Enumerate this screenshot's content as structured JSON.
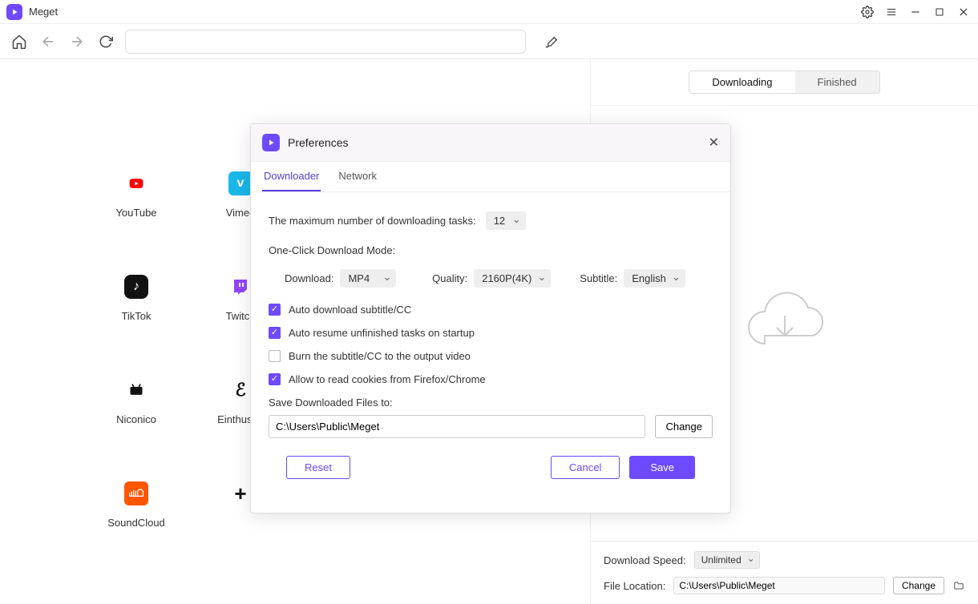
{
  "app": {
    "name": "Meget"
  },
  "titlebar": {
    "gear": "gear",
    "menu": "menu",
    "min": "min",
    "max": "max",
    "close": "close"
  },
  "sites": [
    {
      "label": "YouTube"
    },
    {
      "label": "Vimeo"
    },
    {
      "label": "TikTok"
    },
    {
      "label": "Twitch"
    },
    {
      "label": "Niconico"
    },
    {
      "label": "Einthusan"
    },
    {
      "label": "SoundCloud"
    },
    {
      "label": ""
    }
  ],
  "rightPanel": {
    "tabs": {
      "downloading": "Downloading",
      "finished": "Finished"
    },
    "speedLabel": "Download Speed:",
    "speedValue": "Unlimited",
    "locationLabel": "File Location:",
    "locationValue": "C:\\Users\\Public\\Meget",
    "changeBtn": "Change"
  },
  "prefs": {
    "title": "Preferences",
    "tabs": {
      "downloader": "Downloader",
      "network": "Network"
    },
    "maxTasksLabel": "The maximum number of downloading tasks:",
    "maxTasksValue": "12",
    "oneClickLabel": "One-Click Download Mode:",
    "downloadLabel": "Download:",
    "downloadValue": "MP4",
    "qualityLabel": "Quality:",
    "qualityValue": "2160P(4K)",
    "subtitleLabel": "Subtitle:",
    "subtitleValue": "English",
    "chk1": "Auto download subtitle/CC",
    "chk2": "Auto resume unfinished tasks on startup",
    "chk3": "Burn the subtitle/CC to the output video",
    "chk4": "Allow to read cookies from Firefox/Chrome",
    "saveToLabel": "Save Downloaded Files to:",
    "saveToValue": "C:\\Users\\Public\\Meget",
    "changeBtn": "Change",
    "resetBtn": "Reset",
    "cancelBtn": "Cancel",
    "saveBtn": "Save"
  }
}
